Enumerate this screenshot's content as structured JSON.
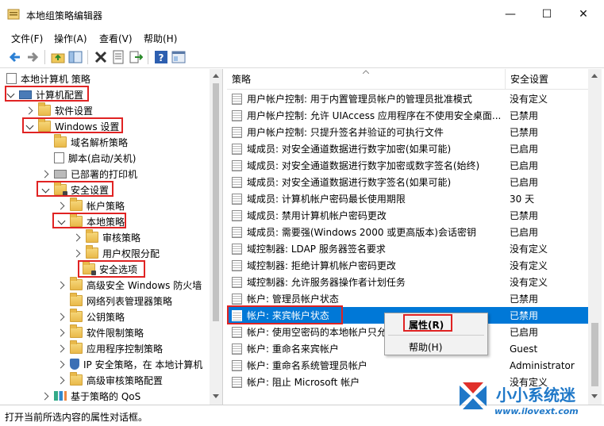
{
  "window": {
    "title": "本地组策略编辑器",
    "min_glyph": "—",
    "max_glyph": "☐",
    "close_glyph": "✕"
  },
  "menu": [
    "文件(F)",
    "操作(A)",
    "查看(V)",
    "帮助(H)"
  ],
  "toolbar": {
    "icons": [
      "back-icon",
      "forward-icon",
      "up-folder-icon",
      "show-hide-tree-icon",
      "delete-icon",
      "properties-icon",
      "export-icon",
      "help-icon",
      "console-icon"
    ]
  },
  "tree": [
    {
      "label": "本地计算机 策略",
      "level": 0,
      "expander": "none",
      "icon": "doc-icon"
    },
    {
      "label": "计算机配置",
      "level": 0,
      "expander": "down",
      "icon": "computer-icon"
    },
    {
      "label": "软件设置",
      "level": 1,
      "expander": "right",
      "icon": "folder-icon"
    },
    {
      "label": "Windows 设置",
      "level": 1,
      "expander": "down",
      "icon": "folder-icon"
    },
    {
      "label": "域名解析策略",
      "level": 2,
      "expander": "none",
      "icon": "folder-icon"
    },
    {
      "label": "脚本(启动/关机)",
      "level": 2,
      "expander": "none",
      "icon": "script-icon"
    },
    {
      "label": "已部署的打印机",
      "level": 2,
      "expander": "right",
      "icon": "printer-icon"
    },
    {
      "label": "安全设置",
      "level": 2,
      "expander": "down",
      "icon": "security-folder-icon"
    },
    {
      "label": "帐户策略",
      "level": 3,
      "expander": "right",
      "icon": "folder-icon"
    },
    {
      "label": "本地策略",
      "level": 3,
      "expander": "down",
      "icon": "folder-icon"
    },
    {
      "label": "审核策略",
      "level": 4,
      "expander": "right",
      "icon": "folder-icon"
    },
    {
      "label": "用户权限分配",
      "level": 4,
      "expander": "right",
      "icon": "folder-icon"
    },
    {
      "label": "安全选项",
      "level": 4,
      "expander": "none",
      "icon": "folder-icon"
    },
    {
      "label": "高级安全 Windows 防火墙",
      "level": 3,
      "expander": "right",
      "icon": "folder-icon"
    },
    {
      "label": "网络列表管理器策略",
      "level": 3,
      "expander": "none",
      "icon": "folder-icon"
    },
    {
      "label": "公钥策略",
      "level": 3,
      "expander": "right",
      "icon": "folder-icon"
    },
    {
      "label": "软件限制策略",
      "level": 3,
      "expander": "right",
      "icon": "folder-icon"
    },
    {
      "label": "应用程序控制策略",
      "level": 3,
      "expander": "right",
      "icon": "folder-icon"
    },
    {
      "label": "IP 安全策略，在 本地计算机",
      "level": 3,
      "expander": "right",
      "icon": "shield-icon"
    },
    {
      "label": "高级审核策略配置",
      "level": 3,
      "expander": "right",
      "icon": "folder-icon"
    },
    {
      "label": "基于策略的 QoS",
      "level": 2,
      "expander": "right",
      "icon": "chart-icon"
    }
  ],
  "list": {
    "col_policy": "策略",
    "col_setting": "安全设置",
    "rows": [
      {
        "policy": "用户帐户控制: 用于内置管理员帐户的管理员批准模式",
        "setting": "没有定义"
      },
      {
        "policy": "用户帐户控制: 允许 UIAccess 应用程序在不使用安全桌面...",
        "setting": "已禁用"
      },
      {
        "policy": "用户帐户控制: 只提升签名并验证的可执行文件",
        "setting": "已禁用"
      },
      {
        "policy": "域成员: 对安全通道数据进行数字加密(如果可能)",
        "setting": "已启用"
      },
      {
        "policy": "域成员: 对安全通道数据进行数字加密或数字签名(始终)",
        "setting": "已启用"
      },
      {
        "policy": "域成员: 对安全通道数据进行数字签名(如果可能)",
        "setting": "已启用"
      },
      {
        "policy": "域成员: 计算机帐户密码最长使用期限",
        "setting": "30 天"
      },
      {
        "policy": "域成员: 禁用计算机帐户密码更改",
        "setting": "已禁用"
      },
      {
        "policy": "域成员: 需要强(Windows 2000 或更高版本)会话密钥",
        "setting": "已启用"
      },
      {
        "policy": "域控制器: LDAP 服务器签名要求",
        "setting": "没有定义"
      },
      {
        "policy": "域控制器: 拒绝计算机帐户密码更改",
        "setting": "没有定义"
      },
      {
        "policy": "域控制器: 允许服务器操作者计划任务",
        "setting": "没有定义"
      },
      {
        "policy": "帐户: 管理员帐户状态",
        "setting": "已禁用"
      },
      {
        "policy": "帐户: 来宾帐户状态",
        "setting": "已禁用"
      },
      {
        "policy": "帐户: 使用空密码的本地帐户只允",
        "setting": "已启用"
      },
      {
        "policy": "帐户: 重命名来宾帐户",
        "setting": "Guest"
      },
      {
        "policy": "帐户: 重命名系统管理员帐户",
        "setting": "Administrator"
      },
      {
        "policy": "帐户: 阻止 Microsoft 帐户",
        "setting": "没有定义"
      }
    ]
  },
  "context_menu": {
    "properties": "属性(R)",
    "help": "帮助(H)"
  },
  "status": "打开当前所选内容的属性对话框。",
  "watermark": {
    "name": "小小系统迷",
    "url": "www.ilovext.com"
  }
}
